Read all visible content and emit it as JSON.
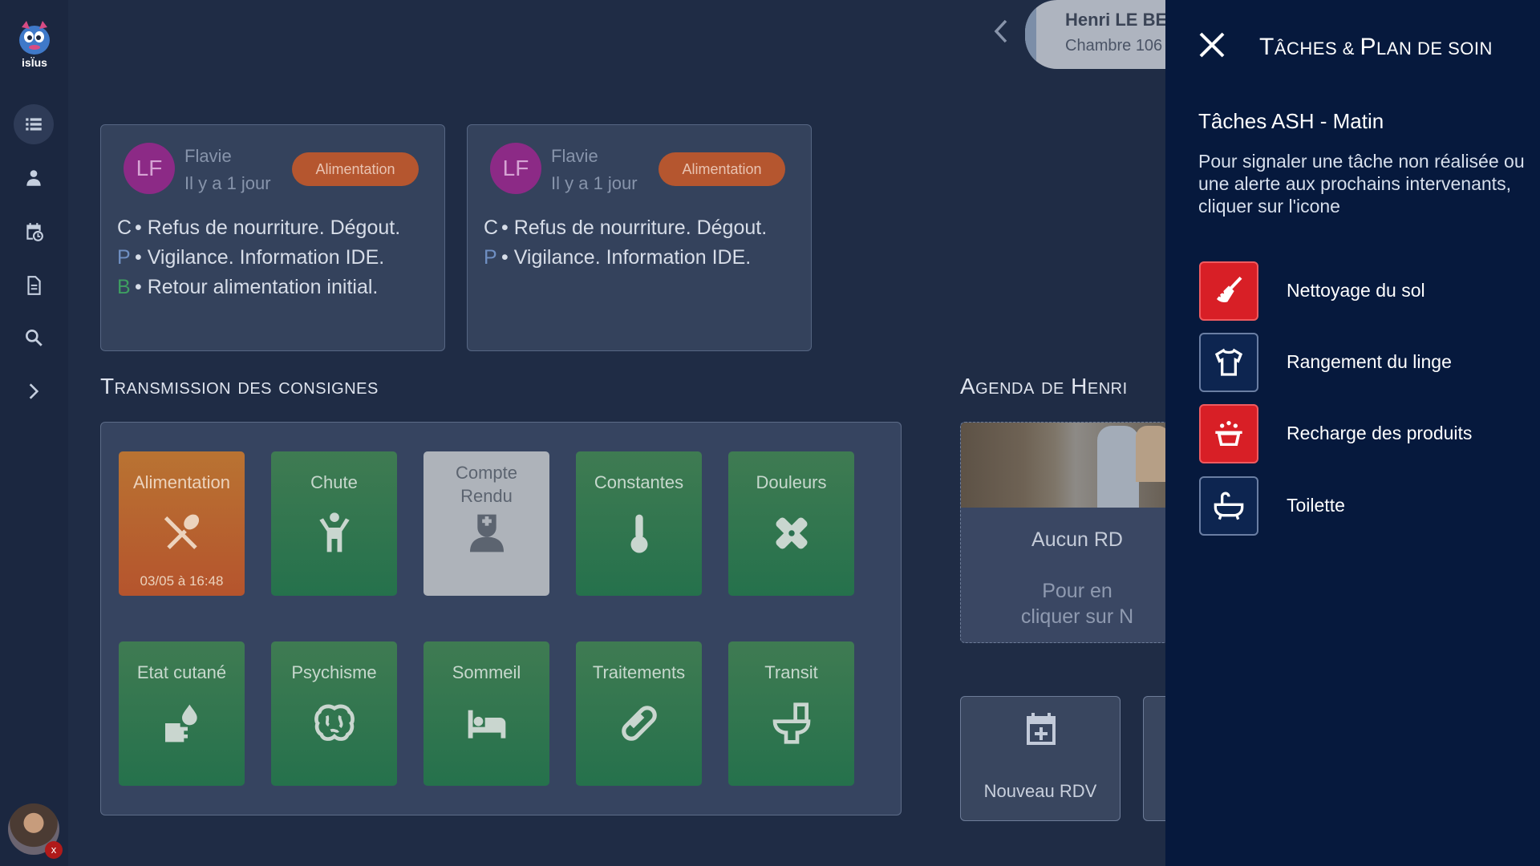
{
  "sidebar": {
    "logo_text": "isÏus",
    "items": [
      {
        "icon": "list-icon",
        "active": true
      },
      {
        "icon": "resident-icon",
        "active": false
      },
      {
        "icon": "calendar-clock-icon",
        "active": false
      },
      {
        "icon": "document-icon",
        "active": false
      },
      {
        "icon": "search-icon",
        "active": false
      },
      {
        "icon": "chevron-right-icon",
        "active": false
      }
    ],
    "user_badge": "x"
  },
  "resident": {
    "name": "Henri LE BE",
    "room": "Chambre 106"
  },
  "transmissions": [
    {
      "initials": "LF",
      "author": "Flavie",
      "ago": "Il y a 1 jour",
      "tag": "Alimentation",
      "lines": [
        {
          "key": "C",
          "text": "• Refus de nourriture. Dégout."
        },
        {
          "key": "P",
          "text": "• Vigilance. Information IDE."
        },
        {
          "key": "B",
          "text": "• Retour alimentation initial."
        }
      ]
    },
    {
      "initials": "LF",
      "author": "Flavie",
      "ago": "Il y a 1 jour",
      "tag": "Alimentation",
      "lines": [
        {
          "key": "C",
          "text": "• Refus de nourriture. Dégout."
        },
        {
          "key": "P",
          "text": "• Vigilance. Information IDE."
        }
      ]
    }
  ],
  "consignes": {
    "title": "Transmission des consignes",
    "tiles": [
      {
        "label": "Alimentation",
        "icon": "utensils-icon",
        "date": "03/05 à 16:48",
        "state": "recent"
      },
      {
        "label": "Chute",
        "icon": "person-fall-icon",
        "state": "normal"
      },
      {
        "label": "Compte Rendu",
        "icon": "nurse-icon",
        "state": "disabled"
      },
      {
        "label": "Constantes",
        "icon": "thermometer-icon",
        "state": "normal"
      },
      {
        "label": "Douleurs",
        "icon": "bandage-icon",
        "state": "normal"
      },
      {
        "label": "Etat cutané",
        "icon": "hand-drop-icon",
        "state": "normal"
      },
      {
        "label": "Psychisme",
        "icon": "brain-icon",
        "state": "normal"
      },
      {
        "label": "Sommeil",
        "icon": "bed-icon",
        "state": "normal"
      },
      {
        "label": "Traitements",
        "icon": "pill-icon",
        "state": "normal"
      },
      {
        "label": "Transit",
        "icon": "toilet-icon",
        "state": "normal"
      }
    ]
  },
  "agenda": {
    "title": "Agenda de Henri",
    "none": "Aucun RD",
    "hint_line1": "Pour en",
    "hint_line2": "cliquer sur N",
    "new_rdv": "Nouveau RDV"
  },
  "panel": {
    "title_first": "T",
    "title_rest": "âches & ",
    "title_p": "P",
    "title_rest2": "lan de soin",
    "subtitle": "Tâches ASH - Matin",
    "description": "Pour signaler une tâche non réalisée ou une alerte aux prochains intervenants, cliquer sur l'icone",
    "tasks": [
      {
        "label": "Nettoyage du sol",
        "icon": "broom-icon",
        "status": "alert",
        "color": "#d81f26"
      },
      {
        "label": "Rangement du linge",
        "icon": "shirt-icon",
        "status": "normal",
        "color": "#0d2550"
      },
      {
        "label": "Recharge des produits",
        "icon": "basket-icon",
        "status": "alert",
        "color": "#d81f26"
      },
      {
        "label": "Toilette",
        "icon": "bathtub-icon",
        "status": "normal",
        "color": "#0d2550"
      }
    ]
  }
}
